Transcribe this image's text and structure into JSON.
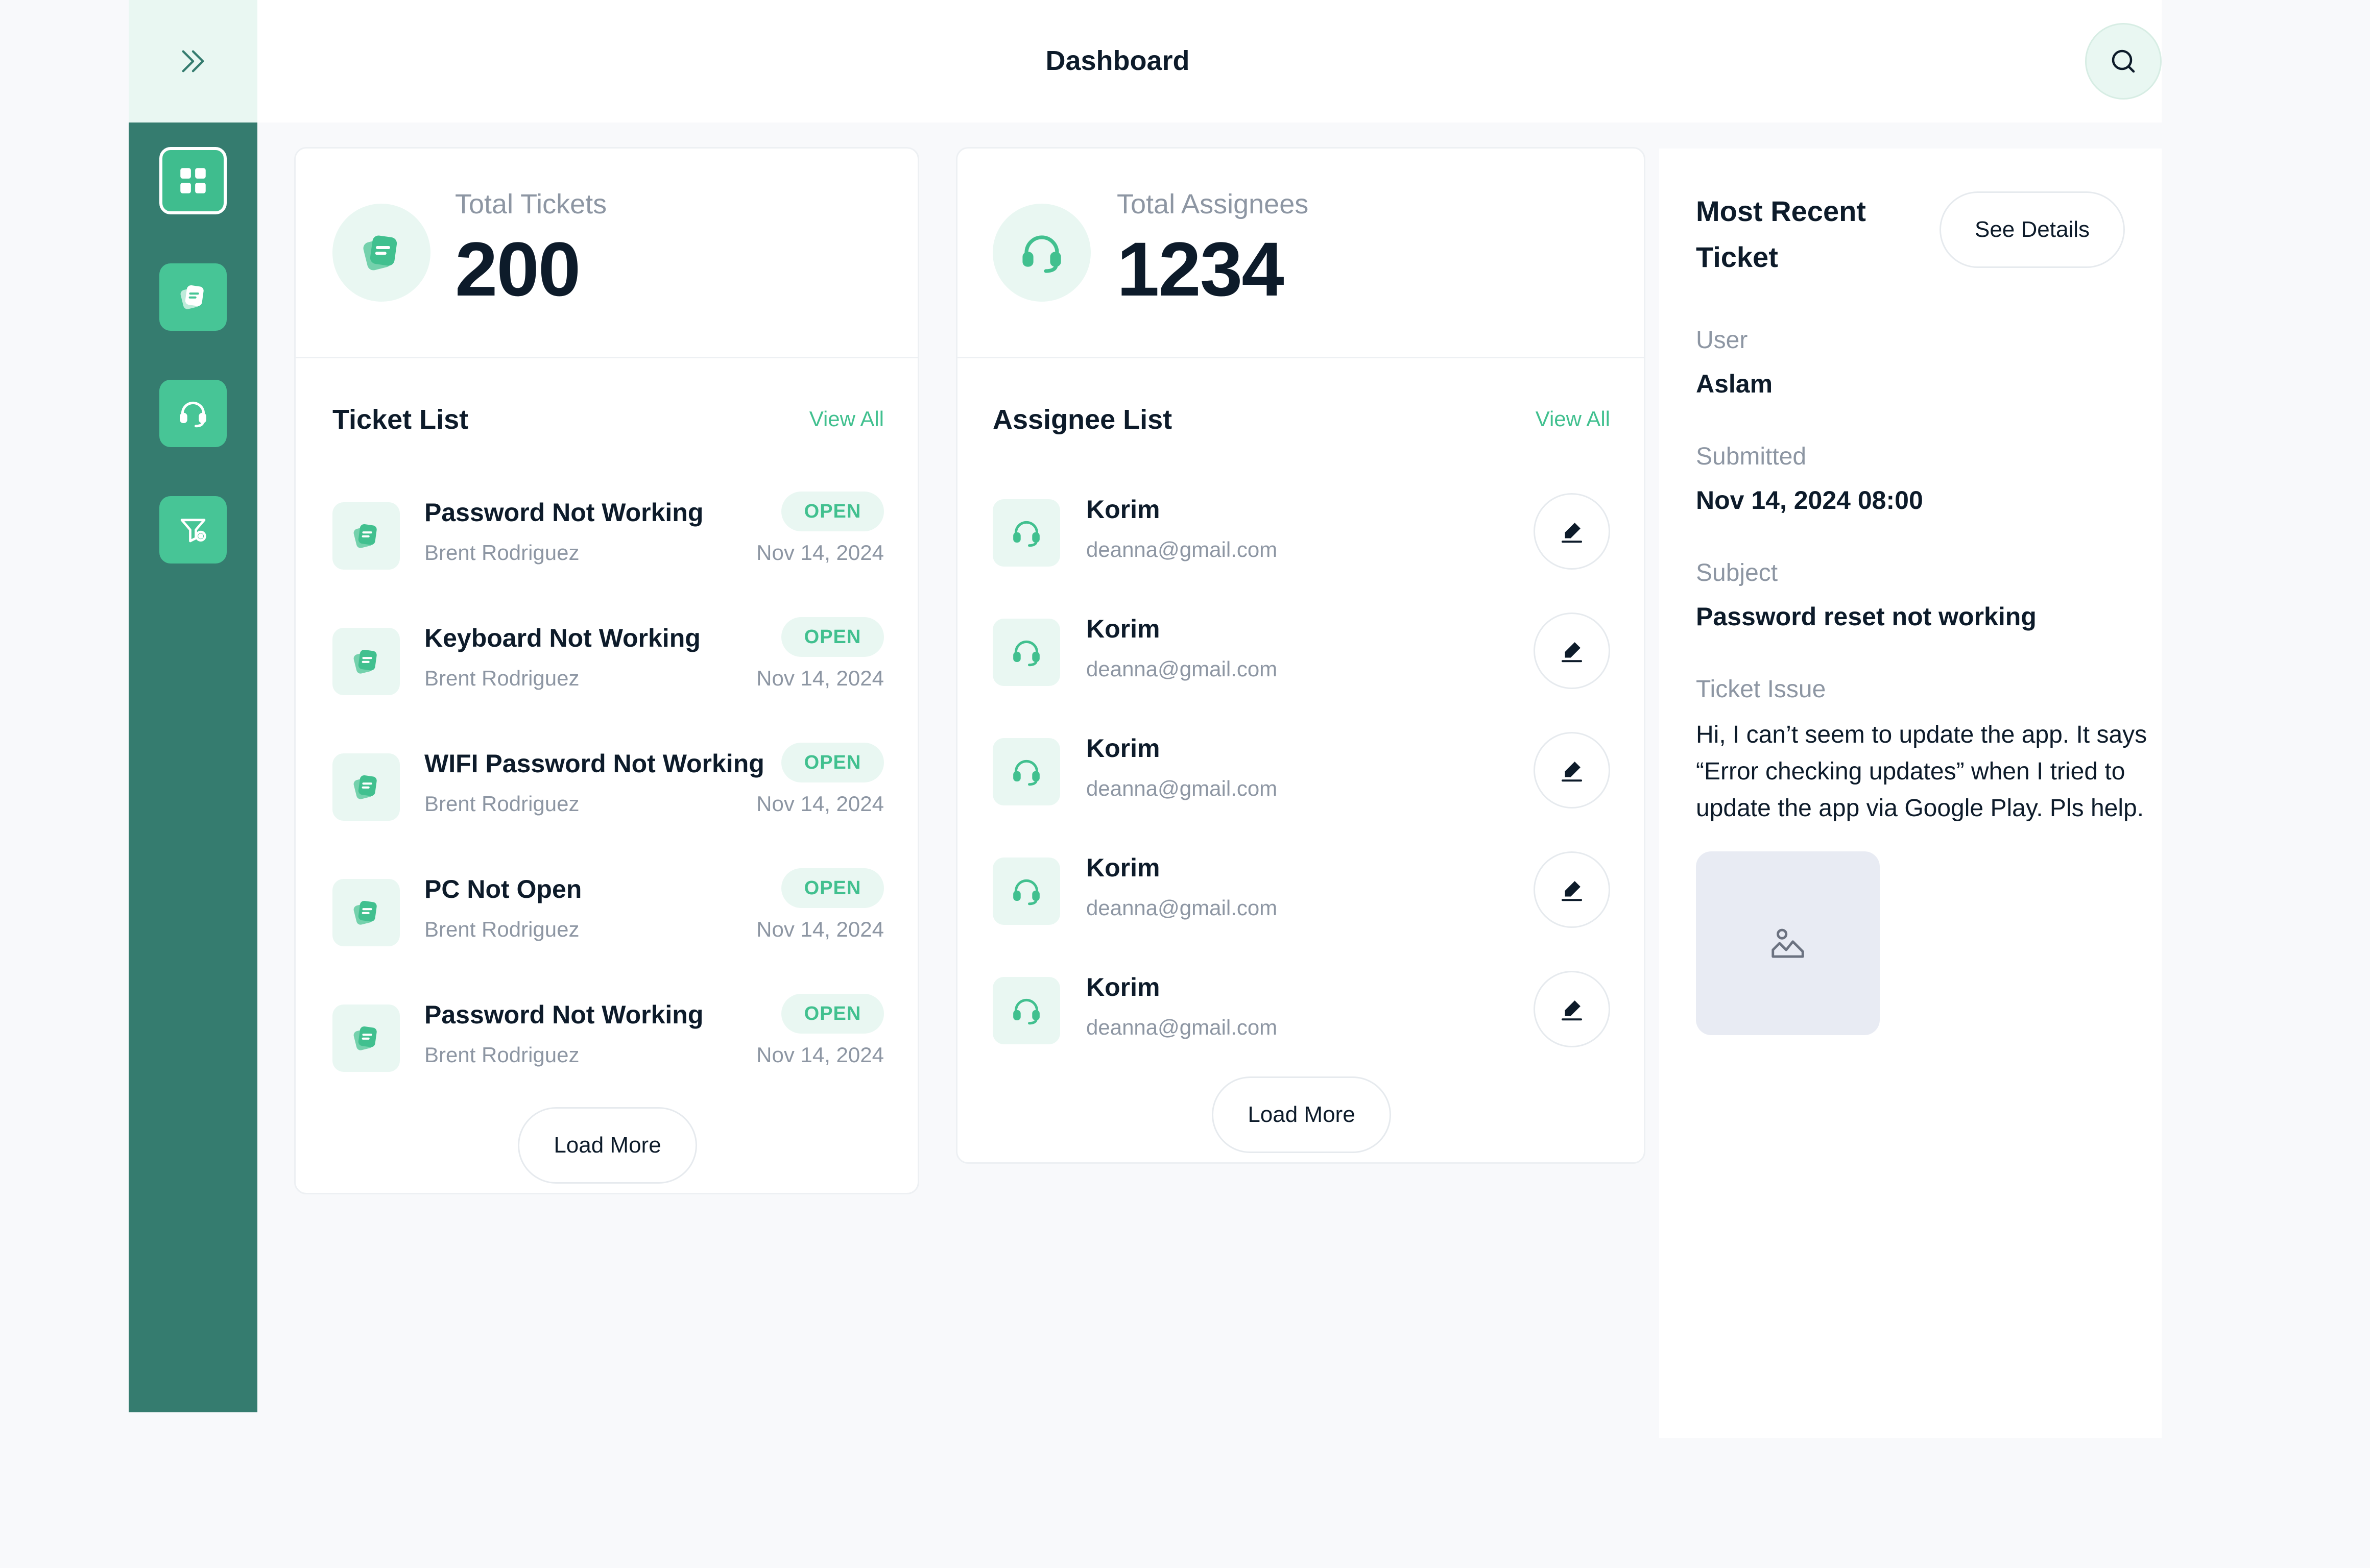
{
  "header": {
    "title": "Dashboard"
  },
  "stats": {
    "tickets": {
      "label": "Total Tickets",
      "value": "200"
    },
    "assignees": {
      "label": "Total Assignees",
      "value": "1234"
    }
  },
  "ticket_list": {
    "title": "Ticket List",
    "view_all": "View All",
    "load_more": "Load More",
    "items": [
      {
        "title": "Password Not Working",
        "requester": "Brent Rodriguez",
        "status": "OPEN",
        "date": "Nov 14, 2024"
      },
      {
        "title": "Keyboard Not Working",
        "requester": "Brent Rodriguez",
        "status": "OPEN",
        "date": "Nov 14, 2024"
      },
      {
        "title": "WIFI Password Not Working",
        "requester": "Brent Rodriguez",
        "status": "OPEN",
        "date": "Nov 14, 2024"
      },
      {
        "title": "PC Not Open",
        "requester": "Brent Rodriguez",
        "status": "OPEN",
        "date": "Nov 14, 2024"
      },
      {
        "title": "Password Not Working",
        "requester": "Brent Rodriguez",
        "status": "OPEN",
        "date": "Nov 14, 2024"
      }
    ]
  },
  "assignee_list": {
    "title": "Assignee List",
    "view_all": "View All",
    "load_more": "Load More",
    "items": [
      {
        "name": "Korim",
        "email": "deanna@gmail.com"
      },
      {
        "name": "Korim",
        "email": "deanna@gmail.com"
      },
      {
        "name": "Korim",
        "email": "deanna@gmail.com"
      },
      {
        "name": "Korim",
        "email": "deanna@gmail.com"
      },
      {
        "name": "Korim",
        "email": "deanna@gmail.com"
      }
    ]
  },
  "recent_ticket": {
    "title": "Most Recent Ticket",
    "see_details": "See Details",
    "user_label": "User",
    "user_value": "Aslam",
    "submitted_label": "Submitted",
    "submitted_value": "Nov 14, 2024 08:00",
    "subject_label": "Subject",
    "subject_value": "Password reset not working",
    "issue_label": "Ticket Issue",
    "issue_text": "Hi, I can’t seem to update the app. It says “Error checking updates” when I tried to update the app via Google Play. Pls help."
  },
  "icons": {
    "sidebar_toggle": "double-chevron-right-icon",
    "nav": [
      "dashboard-grid-icon",
      "tickets-icon",
      "headset-icon",
      "filter-icon"
    ],
    "search": "search-icon",
    "ticket": "tickets-icon",
    "assignee": "headset-icon",
    "edit": "edit-pen-icon",
    "image": "image-placeholder-icon"
  },
  "colors": {
    "sidebar": "#357c6f",
    "accent": "#41c08f",
    "accent_light": "#e9f7f2",
    "text": "#0d1b2a",
    "muted": "#8d96a3"
  }
}
